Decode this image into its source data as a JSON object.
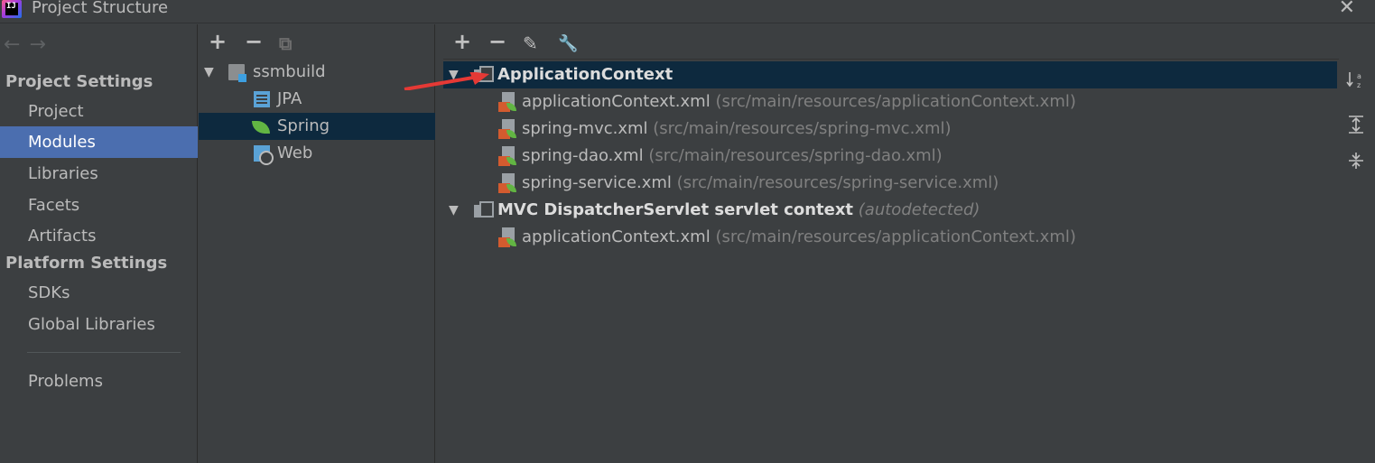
{
  "window": {
    "title": "Project Structure",
    "logo_text": "IJ",
    "close": "✕"
  },
  "nav": {
    "back": "←",
    "forward": "→",
    "project_settings_header": "Project Settings",
    "project_settings_items": [
      {
        "label": "Project",
        "selected": false
      },
      {
        "label": "Modules",
        "selected": true
      },
      {
        "label": "Libraries",
        "selected": false
      },
      {
        "label": "Facets",
        "selected": false
      },
      {
        "label": "Artifacts",
        "selected": false
      }
    ],
    "platform_settings_header": "Platform Settings",
    "platform_settings_items": [
      {
        "label": "SDKs"
      },
      {
        "label": "Global Libraries"
      }
    ],
    "problems": "Problems"
  },
  "modules": {
    "toolbar": {
      "add": "+",
      "remove": "−",
      "copy": "⧉"
    },
    "tree": {
      "root": "ssmbuild",
      "facets": [
        {
          "label": "JPA",
          "icon": "jpa-icon"
        },
        {
          "label": "Spring",
          "icon": "spring-leaf-icon",
          "selected": true
        },
        {
          "label": "Web",
          "icon": "web-icon"
        }
      ]
    }
  },
  "spring": {
    "toolbar": {
      "add": "+",
      "remove": "−",
      "edit": "✎",
      "configure": "🔧"
    },
    "contexts": [
      {
        "name": "ApplicationContext",
        "note": "",
        "files": [
          {
            "name": "applicationContext.xml",
            "path": "(src/main/resources/applicationContext.xml)"
          },
          {
            "name": "spring-mvc.xml",
            "path": "(src/main/resources/spring-mvc.xml)"
          },
          {
            "name": "spring-dao.xml",
            "path": "(src/main/resources/spring-dao.xml)"
          },
          {
            "name": "spring-service.xml",
            "path": "(src/main/resources/spring-service.xml)"
          }
        ]
      },
      {
        "name": "MVC DispatcherServlet servlet context",
        "note": "(autodetected)",
        "files": [
          {
            "name": "applicationContext.xml",
            "path": "(src/main/resources/applicationContext.xml)"
          }
        ]
      }
    ],
    "side_tools": {
      "sort": "↓a z",
      "expand": "⇕",
      "collapse": "⇔"
    }
  },
  "colors": {
    "selection": "#4b6eaf",
    "tree_selection": "#0d293e",
    "annotation_arrow": "#e53935"
  }
}
